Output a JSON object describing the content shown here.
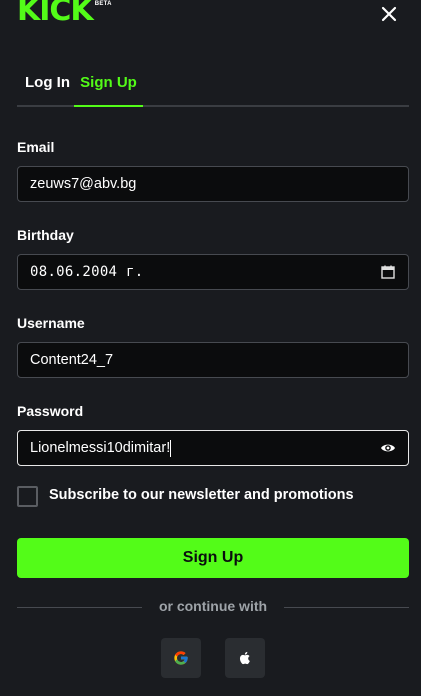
{
  "header": {
    "logo_text": "KICK",
    "logo_badge": "BETA",
    "close_icon": "close-icon"
  },
  "tabs": [
    {
      "label": "Log In",
      "active": false
    },
    {
      "label": "Sign Up",
      "active": true
    }
  ],
  "form": {
    "email": {
      "label": "Email",
      "value": "zeuws7@abv.bg"
    },
    "birthday": {
      "label": "Birthday",
      "value": "08.06.2004 г.",
      "icon": "calendar-icon"
    },
    "username": {
      "label": "Username",
      "value": "Content24_7"
    },
    "password": {
      "label": "Password",
      "value": "Lionelmessi10dimitar!",
      "icon": "eye-icon"
    },
    "newsletter": {
      "label": "Subscribe to our newsletter and promotions",
      "checked": false
    },
    "submit_label": "Sign Up"
  },
  "divider": {
    "text": "or continue with"
  },
  "social": [
    {
      "name": "google",
      "icon": "google-icon"
    },
    {
      "name": "apple",
      "icon": "apple-icon"
    }
  ],
  "colors": {
    "accent": "#53fc18",
    "background": "#191b1f",
    "input_background": "#0b0c0d",
    "input_border": "#474a50"
  }
}
